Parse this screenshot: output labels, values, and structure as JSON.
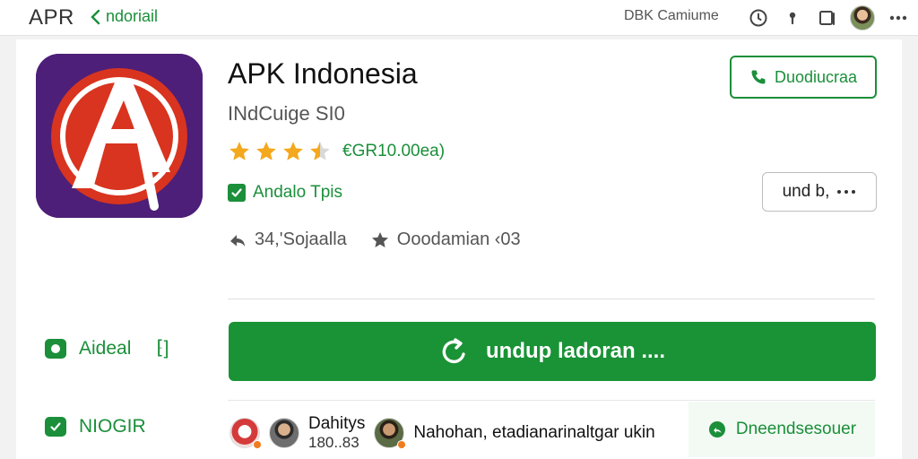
{
  "topbar": {
    "brand": "APR",
    "back_label": "ndoriail",
    "account_name": "DBK Camiume",
    "icons": [
      "clock-icon",
      "location-pin-icon",
      "window-icon",
      "avatar",
      "more-icon"
    ]
  },
  "app": {
    "title": "APK Indonesia",
    "subtitle": "INdCuige SI0",
    "rating_stars": 3.5,
    "rating_text": "€GR10.00ea)",
    "verified_label": "Andalo Tpis",
    "meta": [
      {
        "icon": "share-icon",
        "text": "34,'Sojaalla"
      },
      {
        "icon": "star-badge-icon",
        "text": "Ooodamian ‹03"
      }
    ]
  },
  "buttons": {
    "contact_label": "Duodiucraa",
    "more_label": "und b,",
    "cta_label": "undup ladoran ...."
  },
  "side": {
    "item1_label": "Aideal",
    "item1_suffix": "⁅]",
    "item2_label": "NIOGIR"
  },
  "reviews": {
    "name": "Dahitys",
    "count": "180..83",
    "text": "Nahohan, etadianarinaltgar ukin"
  },
  "share": {
    "label": "Dneendsesouer"
  },
  "colors": {
    "accent": "#1a9236",
    "star": "#f4a81d",
    "icon_bg": "#5a2480",
    "icon_ring": "#d8341f"
  }
}
